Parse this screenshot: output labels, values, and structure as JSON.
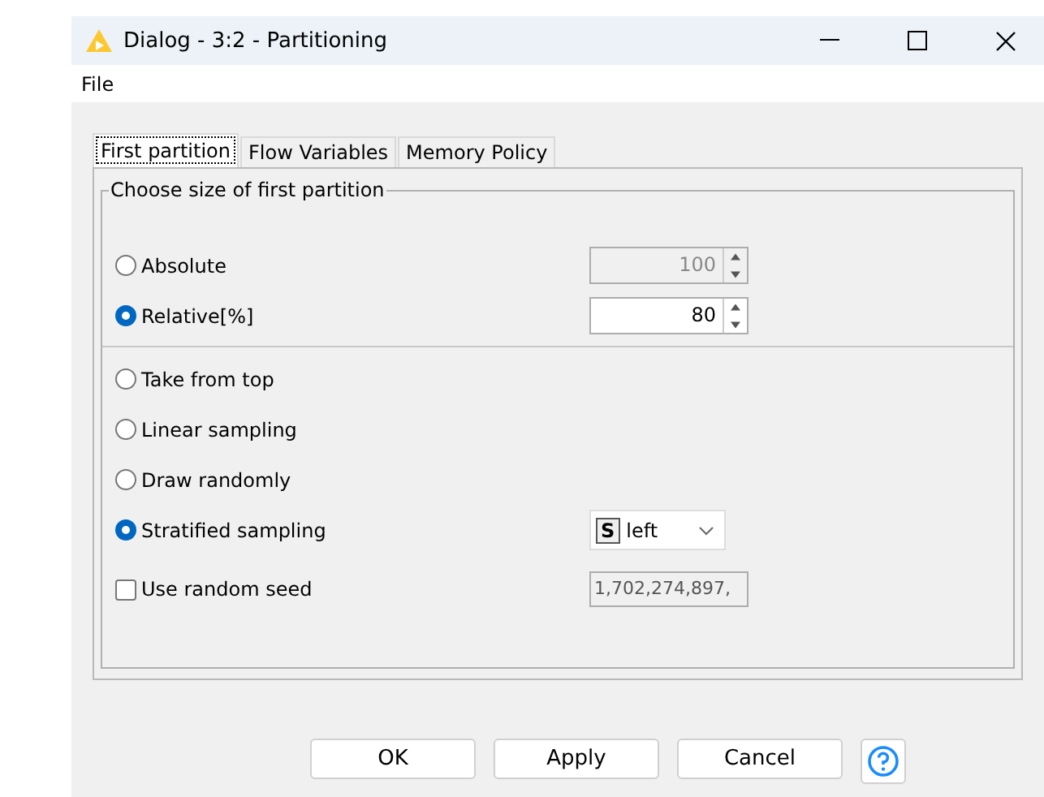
{
  "window": {
    "title": "Dialog - 3:2 - Partitioning"
  },
  "menu": [
    "File"
  ],
  "tabs": [
    {
      "label": "First partition",
      "selected": true
    },
    {
      "label": "Flow Variables",
      "selected": false
    },
    {
      "label": "Memory Policy",
      "selected": false
    }
  ],
  "group": {
    "title": "Choose size of first partition",
    "size_options": [
      {
        "label": "Absolute",
        "selected": false,
        "field": {
          "value": "100",
          "disabled": true
        }
      },
      {
        "label": "Relative[%]",
        "selected": true,
        "field": {
          "value": "80",
          "disabled": false
        }
      }
    ],
    "sampling_options": [
      {
        "label": "Take from top",
        "selected": false
      },
      {
        "label": "Linear sampling",
        "selected": false
      },
      {
        "label": "Draw randomly",
        "selected": false
      },
      {
        "label": "Stratified sampling",
        "selected": true,
        "column_select": {
          "type_badge": "S",
          "value": "left"
        }
      }
    ],
    "seed": {
      "label": "Use random seed",
      "checked": false,
      "field": {
        "value": "1,702,274,897,",
        "disabled": true
      }
    }
  },
  "buttons": [
    "OK",
    "Apply",
    "Cancel"
  ]
}
